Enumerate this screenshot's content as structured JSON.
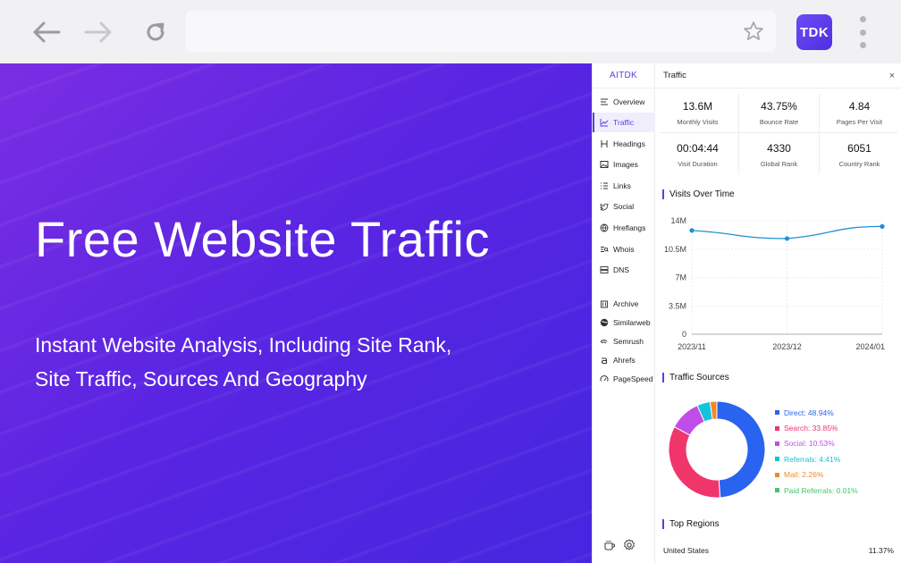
{
  "browser": {
    "back_icon": "arrow-left-icon",
    "forward_icon": "arrow-right-icon",
    "reload_icon": "reload-icon",
    "bookmark_icon": "star-icon",
    "extension_label": "TDK",
    "menu_icon": "kebab-icon"
  },
  "hero": {
    "title": "Free Website Traffic",
    "subtitle_line1": "Instant Website Analysis, Including Site Rank,",
    "subtitle_line2": "Site Traffic, Sources And Geography"
  },
  "panel": {
    "brand": "AITDK",
    "header_title": "Traffic",
    "close_label": "×",
    "nav": [
      {
        "label": "Overview",
        "icon": "list-icon"
      },
      {
        "label": "Traffic",
        "icon": "chart-line-icon"
      },
      {
        "label": "Headings",
        "icon": "heading-icon"
      },
      {
        "label": "Images",
        "icon": "image-icon"
      },
      {
        "label": "Links",
        "icon": "links-icon"
      },
      {
        "label": "Social",
        "icon": "twitter-icon"
      },
      {
        "label": "Hreflangs",
        "icon": "globe-icon"
      },
      {
        "label": "Whois",
        "icon": "whois-icon"
      },
      {
        "label": "DNS",
        "icon": "server-icon"
      },
      {
        "label": "Archive",
        "icon": "archive-icon"
      },
      {
        "label": "Similarweb",
        "icon": "similarweb-icon"
      },
      {
        "label": "Semrush",
        "icon": "semrush-icon"
      },
      {
        "label": "Ahrefs",
        "icon": "ahrefs-icon"
      },
      {
        "label": "PageSpeed",
        "icon": "pagespeed-icon"
      }
    ],
    "active_nav": "Traffic",
    "bottom_icons": [
      "coffee-icon",
      "settings-icon"
    ],
    "stats": [
      {
        "value": "13.6M",
        "label": "Monthly Visits"
      },
      {
        "value": "43.75%",
        "label": "Bounce Rate"
      },
      {
        "value": "4.84",
        "label": "Pages Per Visit"
      },
      {
        "value": "00:04:44",
        "label": "Visit Duration"
      },
      {
        "value": "4330",
        "label": "Global Rank"
      },
      {
        "value": "6051",
        "label": "Country Rank"
      }
    ],
    "visits_title": "Visits Over Time",
    "sources_title": "Traffic Sources",
    "regions_title": "Top Regions",
    "regions": [
      {
        "name": "United States",
        "value": "11.37%"
      }
    ],
    "accent_color": "#5b3de8"
  },
  "chart_data": [
    {
      "type": "line",
      "title": "Visits Over Time",
      "x": [
        "2023/11",
        "2023/12",
        "2024/01"
      ],
      "series": [
        {
          "values": [
            12.8,
            11.8,
            13.3
          ]
        }
      ],
      "y_ticks": [
        "14M",
        "10.5M",
        "7M",
        "3.5M",
        "0"
      ],
      "ylim": [
        0,
        14
      ],
      "grid": true,
      "color": "#1e90d6"
    },
    {
      "type": "pie",
      "title": "Traffic Sources",
      "categories": [
        "Direct",
        "Search",
        "Social",
        "Referrals",
        "Mail",
        "Paid Referrals"
      ],
      "values": [
        48.94,
        33.85,
        10.53,
        4.41,
        2.26,
        0.01
      ],
      "labels": [
        "Direct: 48.94%",
        "Search: 33.85%",
        "Social: 10.53%",
        "Referrals: 4.41%",
        "Mail: 2.26%",
        "Paid Referrals: 0.01%"
      ],
      "colors": [
        "#2a63f0",
        "#f0356b",
        "#c04de8",
        "#16c1db",
        "#f08a24",
        "#46c46c"
      ],
      "legend": "right"
    }
  ]
}
